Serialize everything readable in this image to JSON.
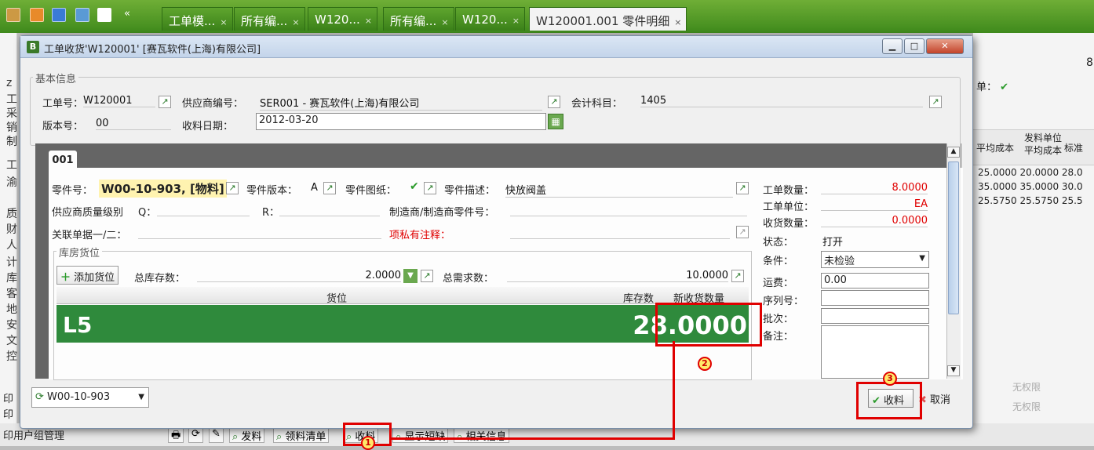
{
  "tabs": [
    {
      "label": "工单模...",
      "active": false
    },
    {
      "label": "所有编...",
      "active": false
    },
    {
      "label": "W120...",
      "active": false
    },
    {
      "label": "所有编...",
      "active": false
    },
    {
      "label": "W120...",
      "active": false
    },
    {
      "label": "W120001.001 零件明细",
      "active": true
    }
  ],
  "tab_close": "×",
  "bg": {
    "left_chars": [
      "z",
      "工",
      "采",
      "销",
      "制",
      "工",
      "渝",
      "质",
      "财",
      "人",
      "计",
      "库",
      "客",
      "地",
      "安",
      "文",
      "控"
    ],
    "left_bottom": [
      "印",
      "印",
      "印用户组管理"
    ],
    "right_headers": [
      "平均成本",
      "发料单位平均成本",
      "标准"
    ],
    "right_rows": [
      [
        "25.0000",
        "20.0000",
        "28.0"
      ],
      [
        "35.0000",
        "35.0000",
        "30.0"
      ],
      [
        "25.5750",
        "25.5750",
        "25.5"
      ]
    ],
    "right_top_num": "8",
    "right_label": "单：",
    "no_perm": [
      "无权限",
      "无权限"
    ],
    "bottom_buttons": [
      "发料",
      "领料清单",
      "收料",
      "显示短缺",
      "相关信息"
    ]
  },
  "dialog": {
    "title": "工单收货'W120001' [赛瓦软件(上海)有限公司]",
    "basic_info": "基本信息",
    "order_no_label": "工单号：",
    "order_no": "W120001",
    "supplier_label": "供应商编号：",
    "supplier": "SER001 - 赛瓦软件(上海)有限公司",
    "account_label": "会计科目：",
    "account": "1405",
    "version_label": "版本号：",
    "version": "00",
    "receive_date_label": "收料日期：",
    "receive_date": "2012-03-20",
    "tab_label": "001",
    "part_label": "零件号：",
    "part_no": "W00-10-903, [物料]",
    "part_ver_label": "零件版本：",
    "part_ver": "A",
    "drawing_label": "零件图纸：",
    "desc_label": "零件描述：",
    "desc": "快放阀盖",
    "quality_label": "供应商质量级别",
    "q_label": "Q：",
    "r_label": "R：",
    "mfr_label": "制造商/制造商零件号：",
    "related_label": "关联单据一/二：",
    "note_label": "项私有注释：",
    "warehouse_label": "库房货位",
    "add_loc": "添加货位",
    "total_stock_label": "总库存数：",
    "total_stock": "2.0000",
    "total_demand_label": "总需求数：",
    "total_demand": "10.0000",
    "col_location": "货位",
    "col_stock": "库存数",
    "col_new_qty": "新收货数量",
    "row_location": "L5",
    "row_qty": "28.0000",
    "order_qty_label": "工单数量：",
    "order_qty": "8.0000",
    "order_unit_label": "工单单位：",
    "order_unit": "EA",
    "received_qty_label": "收货数量：",
    "received_qty": "0.0000",
    "status_label": "状态：",
    "status": "打开",
    "condition_label": "条件：",
    "condition": "未检验",
    "freight_label": "运费：",
    "freight": "0.00",
    "serial_label": "序列号：",
    "batch_label": "批次：",
    "remark_label": "备注：",
    "part_select": "W00-10-903",
    "receive_btn": "收料",
    "cancel_btn": "取消"
  },
  "markers": [
    "1",
    "2",
    "3"
  ],
  "accent": "#e00000"
}
